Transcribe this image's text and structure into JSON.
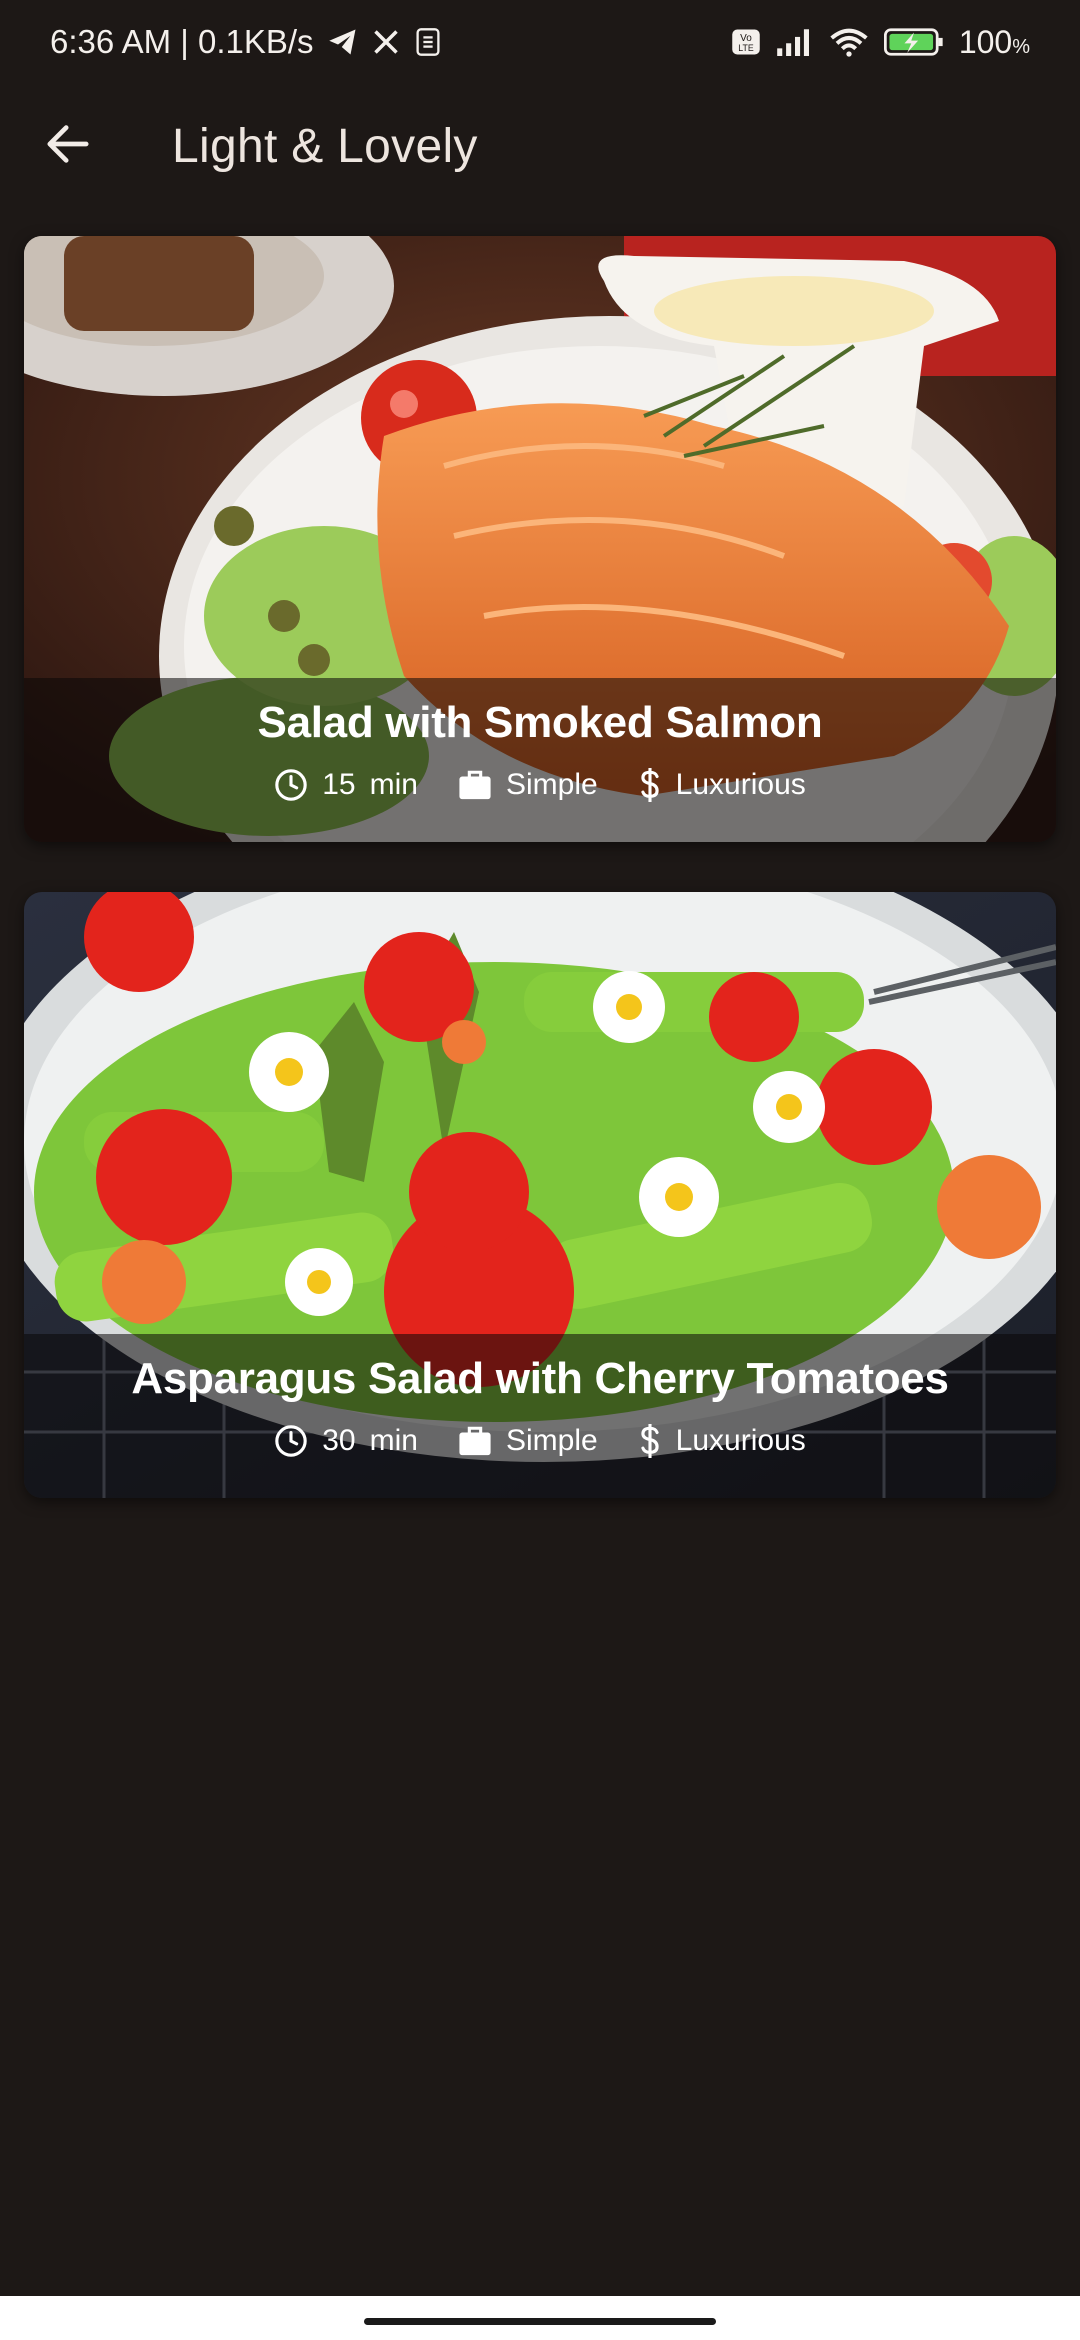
{
  "status_bar": {
    "time_speed": "6:36 AM | 0.1KB/s",
    "battery_percent": "100",
    "battery_unit": "%",
    "icons": [
      "telegram-icon",
      "x-icon",
      "sim-toolkit-icon",
      "volte-icon",
      "signal-icon",
      "wifi-icon",
      "battery-charging-icon"
    ]
  },
  "app_bar": {
    "title": "Light & Lovely",
    "back_icon": "arrow-left-icon"
  },
  "recipes": [
    {
      "title": "Salad with Smoked Salmon",
      "duration": "15",
      "duration_unit": "min",
      "complexity": "Simple",
      "affordability": "Luxurious"
    },
    {
      "title": "Asparagus Salad with Cherry Tomatoes",
      "duration": "30",
      "duration_unit": "min",
      "complexity": "Simple",
      "affordability": "Luxurious"
    }
  ],
  "colors": {
    "background": "#1d1816",
    "text_primary": "#ffffff",
    "overlay": "rgba(10,8,8,0.55)"
  }
}
